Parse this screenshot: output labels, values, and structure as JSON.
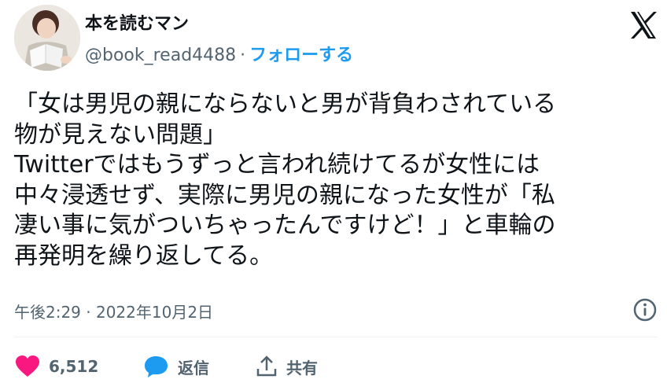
{
  "author": {
    "display_name": "本を読むマン",
    "handle": "@book_read4488",
    "separator": "·",
    "follow_label": "フォローする"
  },
  "tweet": {
    "text": "「女は男児の親にならないと男が背負わされている\n物が見えない問題」\nTwitterではもうずっと言われ続けてるが女性には\n中々浸透せず、実際に男児の親になった女性が「私\n凄い事に気がついちゃったんですけど！」と車輪の\n再発明を繰り返してる。",
    "timestamp": "午後2:29 · 2022年10月2日"
  },
  "actions": {
    "like_count": "6,512",
    "reply_label": "返信",
    "share_label": "共有"
  },
  "icons": {
    "brand": "x-logo-icon",
    "info": "info-icon",
    "like": "heart-icon",
    "reply": "speech-bubble-icon",
    "share": "share-icon"
  },
  "colors": {
    "text": "#0f1419",
    "secondary": "#536471",
    "accent": "#1d9bf0",
    "like": "#f91880"
  }
}
